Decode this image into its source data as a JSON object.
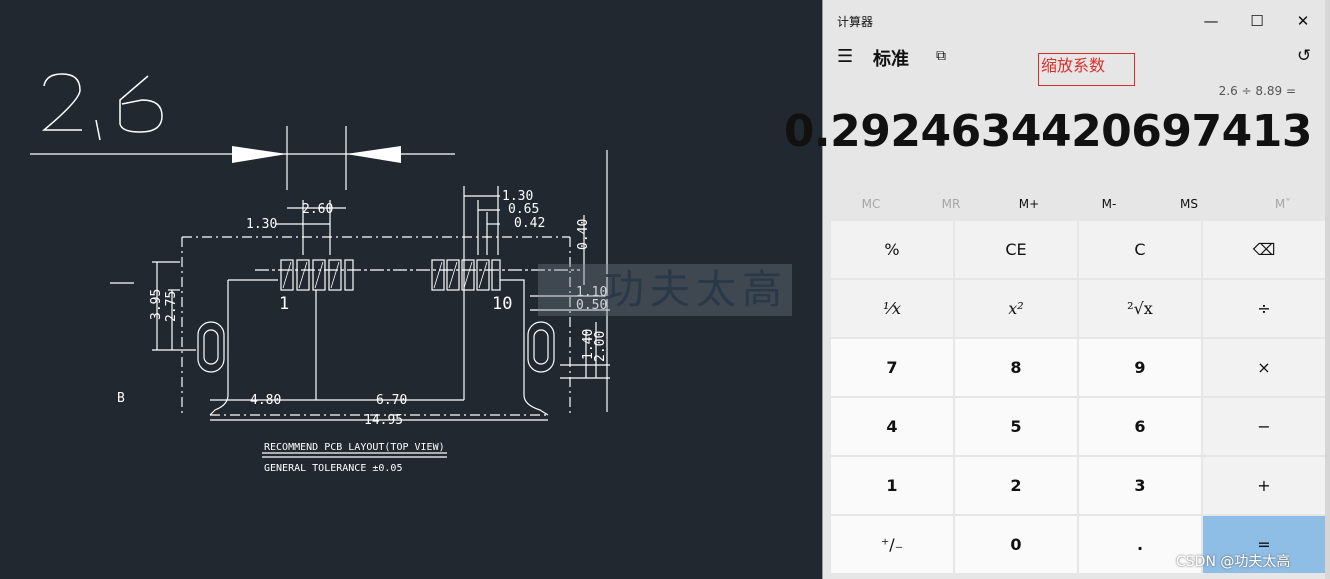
{
  "cad": {
    "scale_label": "2,6",
    "dims": {
      "d260": "2.60",
      "d130a": "1.30",
      "d130b": "1.30",
      "d065": "0.65",
      "d042": "0.42",
      "d040": "0.40",
      "d110": "1.10",
      "d050": "0.50",
      "d395": "3.95",
      "d275": "2.75",
      "d140": "1.40",
      "d200": "2.00",
      "d480": "4.80",
      "d670": "6.70",
      "d1495": "14.95"
    },
    "pin_1": "1",
    "pin_10": "10",
    "left_marker": "B",
    "caption": "RECOMMEND PCB LAYOUT(TOP VIEW)",
    "tolerance": "GENERAL TOLERANCE ±0.05",
    "watermark": "功夫太高"
  },
  "calculator": {
    "app_title": "计算器",
    "mode": "标准",
    "annotation": "缩放系数",
    "expression": "2.6 ÷ 8.89 =",
    "result": "0.2924634420697413",
    "memory": [
      "MC",
      "MR",
      "M+",
      "M-",
      "MS",
      "Mˇ"
    ],
    "keys": [
      [
        "%",
        "CE",
        "C",
        "⌫"
      ],
      [
        "¹⁄x",
        "x²",
        "²√x",
        "÷"
      ],
      [
        "7",
        "8",
        "9",
        "×"
      ],
      [
        "4",
        "5",
        "6",
        "−"
      ],
      [
        "1",
        "2",
        "3",
        "+"
      ],
      [
        "⁺/₋",
        "0",
        ".",
        "="
      ]
    ],
    "watermark_tag": "CSDN @功夫太高"
  },
  "icons": {
    "menu": "hamburger-menu-icon",
    "keep_on_top": "keep-on-top-icon",
    "history": "history-icon",
    "minimize": "minimize-icon",
    "maximize": "maximize-icon",
    "close": "close-icon"
  }
}
